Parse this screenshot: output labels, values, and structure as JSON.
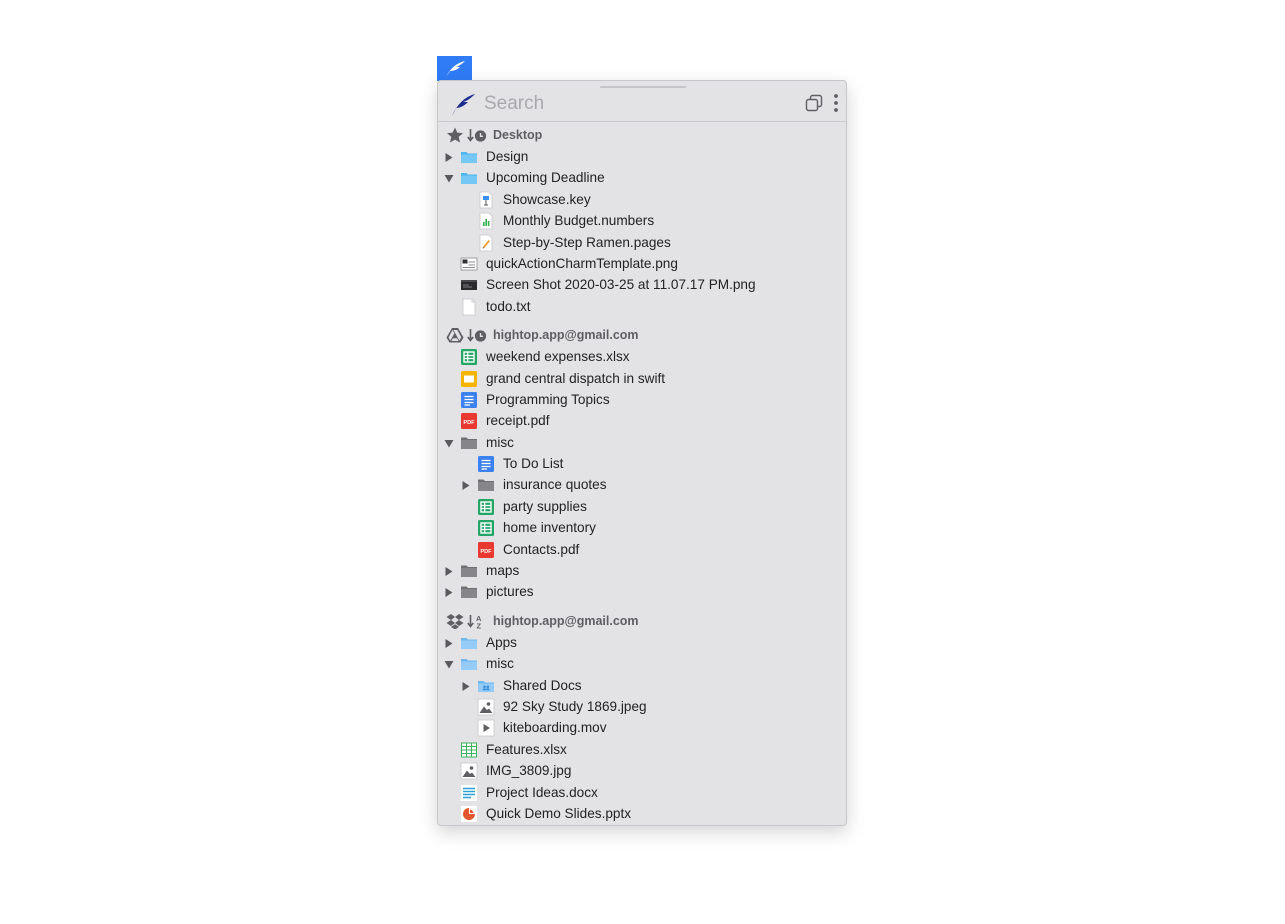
{
  "search": {
    "placeholder": "Search"
  },
  "colors": {
    "accent": "#2f7cf6",
    "panel": "#e3e3e5",
    "logo": "#1b2b8f"
  },
  "groups": [
    {
      "source_icon": "star-icon",
      "sort_icon": "recent-sort-icon",
      "title": "Desktop",
      "items": [
        {
          "label": "Design",
          "level": 0,
          "disclosure": "collapsed",
          "icon": "blue-folder-icon"
        },
        {
          "label": "Upcoming Deadline",
          "level": 0,
          "disclosure": "expanded",
          "icon": "blue-folder-icon"
        },
        {
          "label": "Showcase.key",
          "level": 1,
          "disclosure": "none",
          "icon": "keynote-file-icon"
        },
        {
          "label": "Monthly Budget.numbers",
          "level": 1,
          "disclosure": "none",
          "icon": "numbers-file-icon"
        },
        {
          "label": "Step-by-Step Ramen.pages",
          "level": 1,
          "disclosure": "none",
          "icon": "pages-file-icon"
        },
        {
          "label": "quickActionCharmTemplate.png",
          "level": 0,
          "disclosure": "none",
          "icon": "image-thumb-icon"
        },
        {
          "label": "Screen Shot 2020-03-25 at 11.07.17 PM.png",
          "level": 0,
          "disclosure": "none",
          "icon": "screenshot-thumb-icon"
        },
        {
          "label": "todo.txt",
          "level": 0,
          "disclosure": "none",
          "icon": "text-file-icon"
        }
      ]
    },
    {
      "source_icon": "google-drive-icon",
      "sort_icon": "recent-sort-icon",
      "title": "hightop.app@gmail.com",
      "items": [
        {
          "label": "weekend expenses.xlsx",
          "level": 0,
          "disclosure": "none",
          "icon": "google-sheets-icon"
        },
        {
          "label": "grand central dispatch in swift",
          "level": 0,
          "disclosure": "none",
          "icon": "google-slides-icon"
        },
        {
          "label": "Programming Topics",
          "level": 0,
          "disclosure": "none",
          "icon": "google-docs-icon"
        },
        {
          "label": "receipt.pdf",
          "level": 0,
          "disclosure": "none",
          "icon": "pdf-icon"
        },
        {
          "label": "misc",
          "level": 0,
          "disclosure": "expanded",
          "icon": "gray-folder-icon"
        },
        {
          "label": "To Do List",
          "level": 1,
          "disclosure": "none",
          "icon": "google-docs-icon"
        },
        {
          "label": "insurance quotes",
          "level": 1,
          "disclosure": "collapsed",
          "icon": "gray-folder-icon"
        },
        {
          "label": "party supplies",
          "level": 1,
          "disclosure": "none",
          "icon": "google-sheets-icon"
        },
        {
          "label": "home inventory",
          "level": 1,
          "disclosure": "none",
          "icon": "google-sheets-icon"
        },
        {
          "label": "Contacts.pdf",
          "level": 1,
          "disclosure": "none",
          "icon": "pdf-icon"
        },
        {
          "label": "maps",
          "level": 0,
          "disclosure": "collapsed",
          "icon": "gray-folder-icon"
        },
        {
          "label": "pictures",
          "level": 0,
          "disclosure": "collapsed",
          "icon": "gray-folder-icon"
        }
      ]
    },
    {
      "source_icon": "dropbox-icon",
      "sort_icon": "alpha-sort-icon",
      "title": "hightop.app@gmail.com",
      "items": [
        {
          "label": "Apps",
          "level": 0,
          "disclosure": "collapsed",
          "icon": "lightblue-folder-icon"
        },
        {
          "label": "misc",
          "level": 0,
          "disclosure": "expanded",
          "icon": "lightblue-folder-icon"
        },
        {
          "label": "Shared Docs",
          "level": 1,
          "disclosure": "collapsed",
          "icon": "shared-folder-icon"
        },
        {
          "label": "92 Sky Study 1869.jpeg",
          "level": 1,
          "disclosure": "none",
          "icon": "photo-file-icon"
        },
        {
          "label": "kiteboarding.mov",
          "level": 1,
          "disclosure": "none",
          "icon": "video-file-icon"
        },
        {
          "label": "Features.xlsx",
          "level": 0,
          "disclosure": "none",
          "icon": "spreadsheet-file-icon"
        },
        {
          "label": "IMG_3809.jpg",
          "level": 0,
          "disclosure": "none",
          "icon": "photo-file-icon"
        },
        {
          "label": "Project Ideas.docx",
          "level": 0,
          "disclosure": "none",
          "icon": "document-file-icon"
        },
        {
          "label": "Quick Demo Slides.pptx",
          "level": 0,
          "disclosure": "none",
          "icon": "presentation-file-icon"
        }
      ]
    }
  ]
}
